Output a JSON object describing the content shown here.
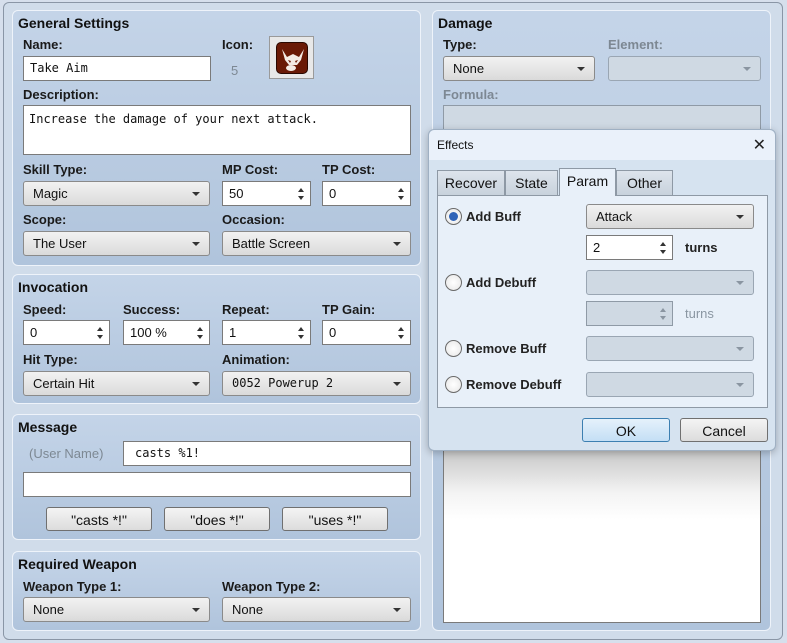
{
  "general": {
    "title": "General Settings",
    "name_label": "Name:",
    "name_value": "Take Aim",
    "icon_label": "Icon:",
    "icon_index": "5",
    "icon_name": "demon-face-icon",
    "description_label": "Description:",
    "description_value": "Increase the damage of your next attack.",
    "skill_type_label": "Skill Type:",
    "skill_type_value": "Magic",
    "mp_cost_label": "MP Cost:",
    "mp_cost_value": "50",
    "tp_cost_label": "TP Cost:",
    "tp_cost_value": "0",
    "scope_label": "Scope:",
    "scope_value": "The User",
    "occasion_label": "Occasion:",
    "occasion_value": "Battle Screen"
  },
  "invocation": {
    "title": "Invocation",
    "speed_label": "Speed:",
    "speed_value": "0",
    "success_label": "Success:",
    "success_value": "100 %",
    "repeat_label": "Repeat:",
    "repeat_value": "1",
    "tp_gain_label": "TP Gain:",
    "tp_gain_value": "0",
    "hit_type_label": "Hit Type:",
    "hit_type_value": "Certain Hit",
    "animation_label": "Animation:",
    "animation_value": "0052 Powerup 2"
  },
  "message": {
    "title": "Message",
    "user_name_label": "(User Name)",
    "line1_value": "casts %1!",
    "line2_value": "",
    "buttons": [
      "\"casts *!\"",
      "\"does *!\"",
      "\"uses *!\""
    ]
  },
  "required_weapon": {
    "title": "Required Weapon",
    "type1_label": "Weapon Type 1:",
    "type1_value": "None",
    "type2_label": "Weapon Type 2:",
    "type2_value": "None"
  },
  "damage": {
    "title": "Damage",
    "type_label": "Type:",
    "type_value": "None",
    "element_label": "Element:",
    "element_value": "",
    "formula_label": "Formula:",
    "formula_value": ""
  },
  "effects_dialog": {
    "title": "Effects",
    "close_icon": "close-icon",
    "tabs": [
      {
        "label": "Recover",
        "active": false
      },
      {
        "label": "State",
        "active": false
      },
      {
        "label": "Param",
        "active": true
      },
      {
        "label": "Other",
        "active": false
      }
    ],
    "options": [
      {
        "label": "Add Buff",
        "checked": true,
        "param": "Attack",
        "turns": "2",
        "has_turns": true
      },
      {
        "label": "Add Debuff",
        "checked": false,
        "param": "",
        "turns": "",
        "has_turns": true
      },
      {
        "label": "Remove Buff",
        "checked": false,
        "param": "",
        "has_turns": false
      },
      {
        "label": "Remove Debuff",
        "checked": false,
        "param": "",
        "has_turns": false
      }
    ],
    "turns_label": "turns",
    "ok_label": "OK",
    "cancel_label": "Cancel"
  },
  "colors": {
    "panel": "#c4d4e8",
    "primary_button": "#c4dff5",
    "radio_checked": "#3064b8",
    "icon_bg": "#6a1a06"
  }
}
